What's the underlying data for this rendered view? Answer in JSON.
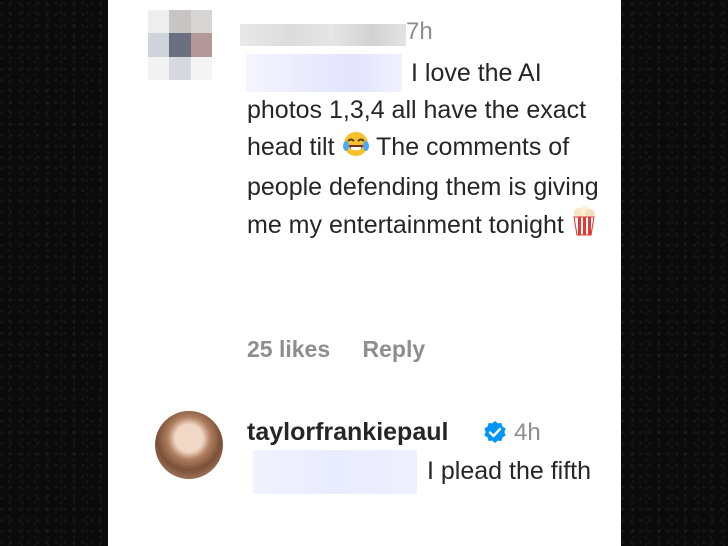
{
  "comment1": {
    "time": "7h",
    "text_lines_1": "I love the AI photos 1,3,4 all have the exact head tilt",
    "text_lines_2": "The comments of people defending them is giving me my entertainment tonight",
    "likes": "25 likes",
    "reply_label": "Reply",
    "emoji_1": "laughing-crying-emoji",
    "emoji_2": "popcorn-emoji"
  },
  "comment2": {
    "username": "taylorfrankiepaul",
    "time": "4h",
    "text": "I plead the fifth",
    "verified_color": "#0095f6"
  },
  "colors": {
    "text": "#262626",
    "muted": "#8e8e8e",
    "background": "#0b0b0b",
    "panel": "#ffffff"
  }
}
